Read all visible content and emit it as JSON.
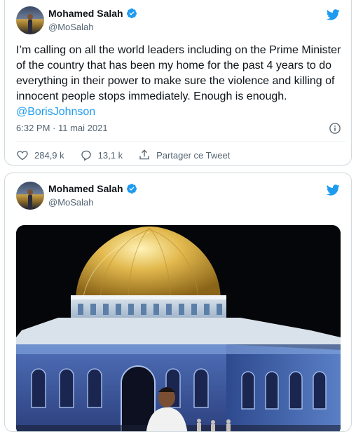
{
  "tweets": [
    {
      "author_name": "Mohamed Salah",
      "author_handle": "@MoSalah",
      "text_body": "I’m calling on all the world leaders including on the Prime Minister of the country that has been my home for the past 4 years to do everything in their power to make sure the violence and killing of innocent people stops immediately. Enough is enough.",
      "mention": "@BorisJohnson",
      "timestamp": "6:32 PM · 11 mai 2021",
      "likes": "284,9 k",
      "replies": "13,1 k",
      "share_label": "Partager ce Tweet"
    },
    {
      "author_name": "Mohamed Salah",
      "author_handle": "@MoSalah"
    }
  ],
  "colors": {
    "accent": "#1d9bf0",
    "secondary_text": "#536471",
    "border": "#cfd9de"
  },
  "icons": [
    "twitter-bird-icon",
    "verified-badge-icon",
    "info-icon",
    "heart-icon",
    "reply-icon",
    "share-icon"
  ]
}
